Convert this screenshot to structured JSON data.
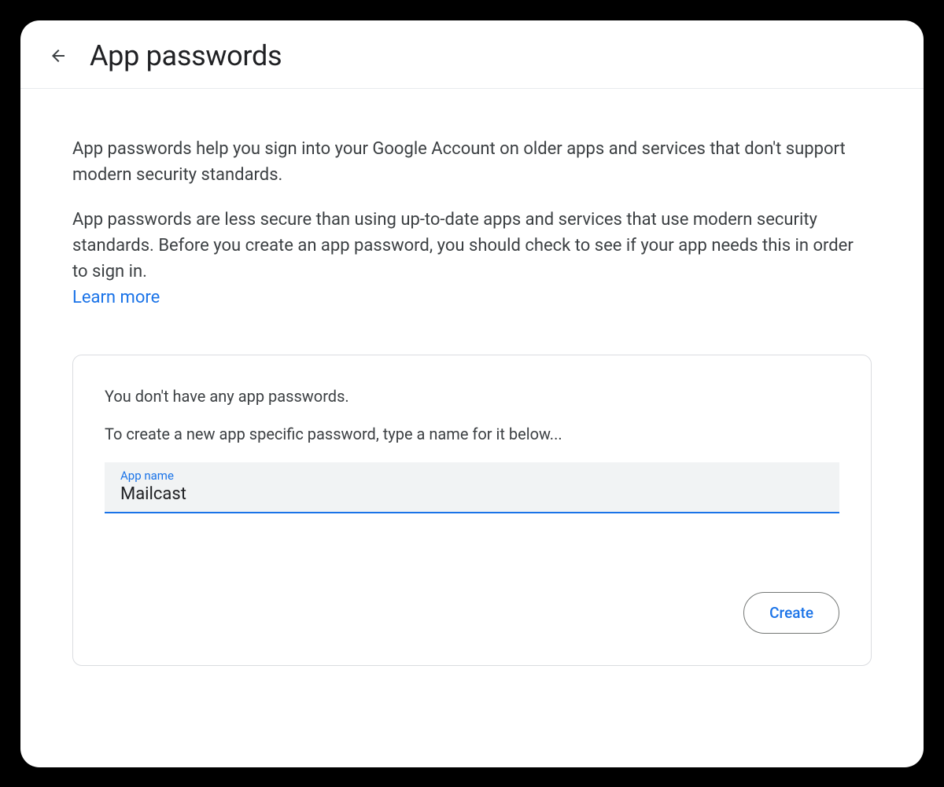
{
  "header": {
    "title": "App passwords"
  },
  "content": {
    "paragraph1": "App passwords help you sign into your Google Account on older apps and services that don't support modern security standards.",
    "paragraph2": "App passwords are less secure than using up-to-date apps and services that use modern security standards. Before you create an app password, you should check to see if your app needs this in order to sign in.",
    "learn_more_label": "Learn more"
  },
  "card": {
    "empty_state_text": "You don't have any app passwords.",
    "instruction_text": "To create a new app specific password, type a name for it below...",
    "input_label": "App name",
    "input_value": "Mailcast",
    "create_button_label": "Create"
  }
}
